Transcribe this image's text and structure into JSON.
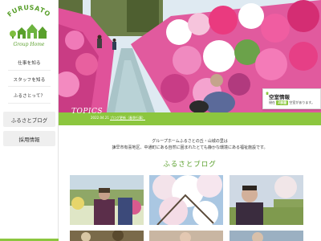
{
  "sidebar": {
    "logo_text": "FURUSATO",
    "logo_subtext": "Group Home",
    "nav": [
      {
        "label": "仕事を知る"
      },
      {
        "label": "スタッフを知る"
      },
      {
        "label": "ふるさとって？"
      }
    ],
    "buttons": [
      {
        "label": "ふるさとブログ"
      },
      {
        "label": "採用情報"
      }
    ]
  },
  "vacancy": {
    "title": "空室情報",
    "text_prefix": "現在",
    "count": "2部屋",
    "text_suffix": "空室があります。"
  },
  "topics": {
    "label": "TOPICS",
    "date": "2022.04.21",
    "link_text": "ブログ更新（春季行事）"
  },
  "intro": {
    "line1": "グループホームふるさとの丘・山城の里は",
    "line2": "諫早市有喜地区、中通町にある自然に囲まれたとても静かな環境にある福祉施設です。"
  },
  "blog": {
    "title": "ふるさとブログ"
  },
  "colors": {
    "accent_green": "#8cc63f",
    "title_green": "#5aa02c"
  }
}
